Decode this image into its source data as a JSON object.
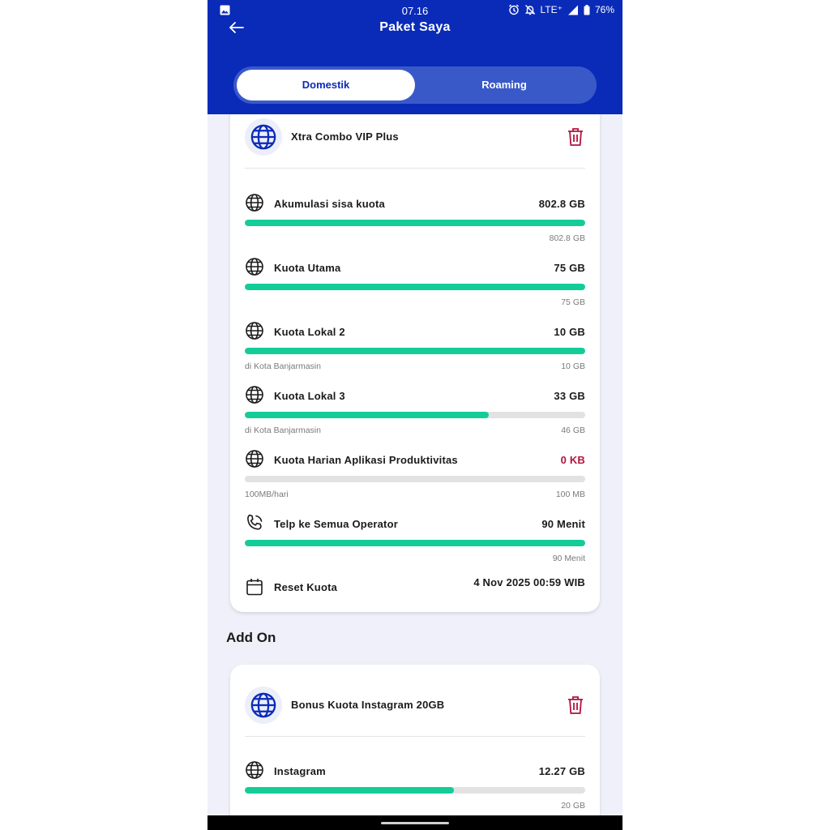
{
  "status_bar": {
    "time": "07.16",
    "network": "LTE⁺",
    "battery": "76%"
  },
  "header": {
    "title": "Paket Saya",
    "tabs": [
      {
        "label": "Domestik",
        "active": true
      },
      {
        "label": "Roaming",
        "active": false
      }
    ]
  },
  "main_package": {
    "name": "Xtra Combo VIP Plus",
    "quotas": [
      {
        "label": "Akumulasi sisa kuota",
        "value": "802.8 GB",
        "note": "",
        "total": "802.8 GB",
        "fill": 1.0,
        "icon": "globe-icon"
      },
      {
        "label": "Kuota Utama",
        "value": "75 GB",
        "note": "",
        "total": "75 GB",
        "fill": 1.0,
        "icon": "globe-icon"
      },
      {
        "label": "Kuota Lokal 2",
        "value": "10 GB",
        "note": "di Kota Banjarmasin",
        "total": "10 GB",
        "fill": 1.0,
        "icon": "globe-icon"
      },
      {
        "label": "Kuota Lokal 3",
        "value": "33 GB",
        "note": "di Kota Banjarmasin",
        "total": "46 GB",
        "fill": 0.717,
        "icon": "globe-icon"
      },
      {
        "label": "Kuota Harian Aplikasi Produktivitas",
        "value": "0 KB",
        "note": "100MB/hari",
        "total": "100 MB",
        "fill": 0.0,
        "icon": "globe-icon"
      },
      {
        "label": "Telp ke Semua Operator",
        "value": "90 Menit",
        "note": "",
        "total": "90 Menit",
        "fill": 1.0,
        "icon": "phone-icon"
      }
    ],
    "reset": {
      "label": "Reset Kuota",
      "value": "4 Nov 2025 00:59 WIB"
    }
  },
  "addon": {
    "heading": "Add On",
    "package": {
      "name": "Bonus Kuota Instagram 20GB",
      "quota": {
        "label": "Instagram",
        "value": "12.27 GB",
        "note": "",
        "total": "20 GB",
        "fill": 0.6135,
        "icon": "globe-icon"
      }
    }
  },
  "colors": {
    "header": "#0a2bb8",
    "progress": "#14cc97",
    "danger": "#b3133f",
    "background": "#eff0fa"
  }
}
